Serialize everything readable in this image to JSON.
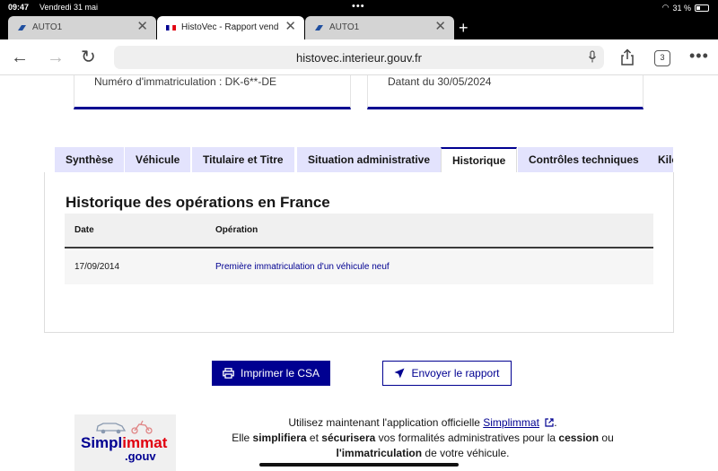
{
  "status": {
    "time": "09:47",
    "date": "Vendredi 31 mai",
    "battery": "31 %",
    "battery_level": 0.31
  },
  "browser": {
    "tabs": [
      {
        "label": "AUTO1",
        "active": false
      },
      {
        "label": "HistoVec - Rapport vendeur",
        "active": true
      },
      {
        "label": "AUTO1",
        "active": false
      }
    ],
    "url": "histovec.interieur.gouv.fr",
    "tab_count": "3"
  },
  "cards": {
    "immat": "Numéro d'immatriculation : DK-6**-DE",
    "date": "Datant du 30/05/2024"
  },
  "page_tabs": [
    "Synthèse",
    "Véhicule",
    "Titulaire et Titre",
    "Situation administrative",
    "Historique",
    "Contrôles techniques",
    "Kilométrage"
  ],
  "history": {
    "title": "Historique des opérations en France",
    "columns": {
      "date": "Date",
      "operation": "Opération"
    },
    "rows": [
      {
        "date": "17/09/2014",
        "operation": "Première immatriculation d'un véhicule neuf"
      }
    ]
  },
  "actions": {
    "print": "Imprimer le CSA",
    "send": "Envoyer le rapport"
  },
  "footer": {
    "logo_main_1": "Simpl",
    "logo_main_2": "immat",
    "logo_sub": ".gouv",
    "line1_pre": "Utilisez maintenant l'application officielle ",
    "link": "Simplimmat",
    "line1_post": ".",
    "line2_pre": "Elle ",
    "simplifiera": "simplifiera",
    "et": " et ",
    "securisera": "sécurisera",
    "line2_mid": " vos formalités administratives pour la ",
    "cession": "cession",
    "ou": " ou",
    "immatriculation": "l'immatriculation",
    "line3_post": " de votre véhicule."
  }
}
